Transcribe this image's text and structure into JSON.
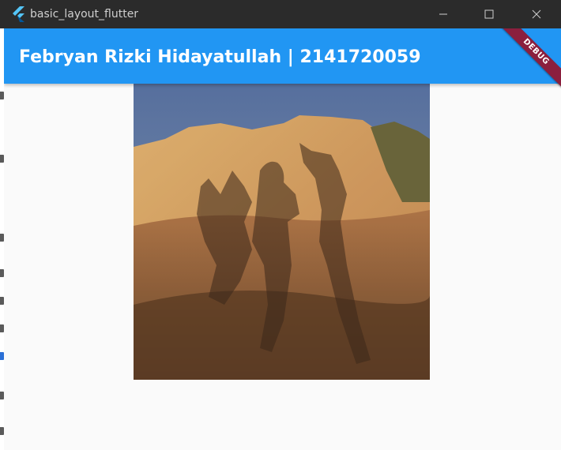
{
  "window": {
    "title": "basic_layout_flutter",
    "icon": "flutter-logo-icon",
    "controls": [
      "minimize-icon",
      "maximize-icon",
      "close-icon"
    ]
  },
  "appbar": {
    "title": "Febryan Rizki Hidayatullah | 2141720059",
    "color": "#2196F3"
  },
  "debug_banner": {
    "label": "DEBUG",
    "color": "#8B1F3E"
  },
  "body": {
    "image": "photo of three people's shadows cast on a sandstone rock formation at sunset"
  }
}
